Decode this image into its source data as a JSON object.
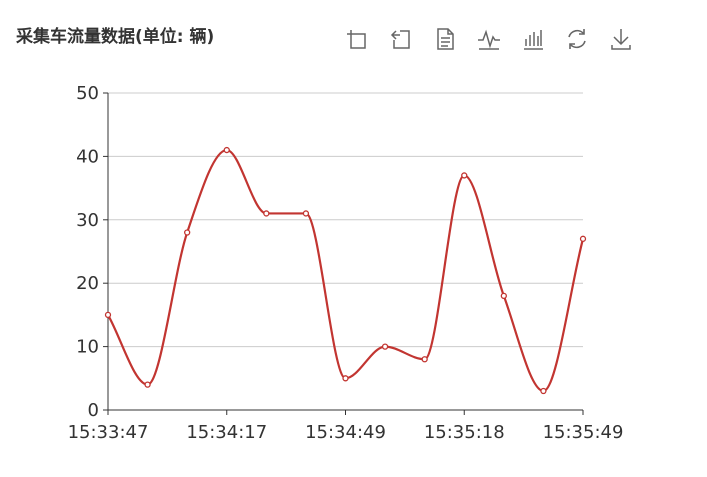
{
  "title": "采集车流量数据(单位: 辆)",
  "toolbox": {
    "items": [
      {
        "icon": "zoom-icon"
      },
      {
        "icon": "zoom-reset-icon"
      },
      {
        "icon": "data-view-icon"
      },
      {
        "icon": "line-chart-icon"
      },
      {
        "icon": "bar-chart-icon"
      },
      {
        "icon": "restore-icon"
      },
      {
        "icon": "download-icon"
      }
    ]
  },
  "chart_data": {
    "type": "line",
    "smooth": true,
    "title": "采集车流量数据(单位: 辆)",
    "xlabel": "",
    "ylabel": "",
    "x_tick_labels": [
      "15:33:47",
      "15:34:17",
      "15:34:49",
      "15:35:18",
      "15:35:49"
    ],
    "y_tick_labels": [
      "0",
      "10",
      "20",
      "30",
      "40",
      "50"
    ],
    "ylim": [
      0,
      50
    ],
    "grid": true,
    "legend": "none",
    "series": [
      {
        "values": [
          15,
          4,
          28,
          41,
          31,
          31,
          5,
          10,
          8,
          37,
          18,
          3,
          27
        ]
      }
    ],
    "colors": {
      "line": "#c23531",
      "grid": "#cccccc",
      "axis": "#333333"
    }
  }
}
